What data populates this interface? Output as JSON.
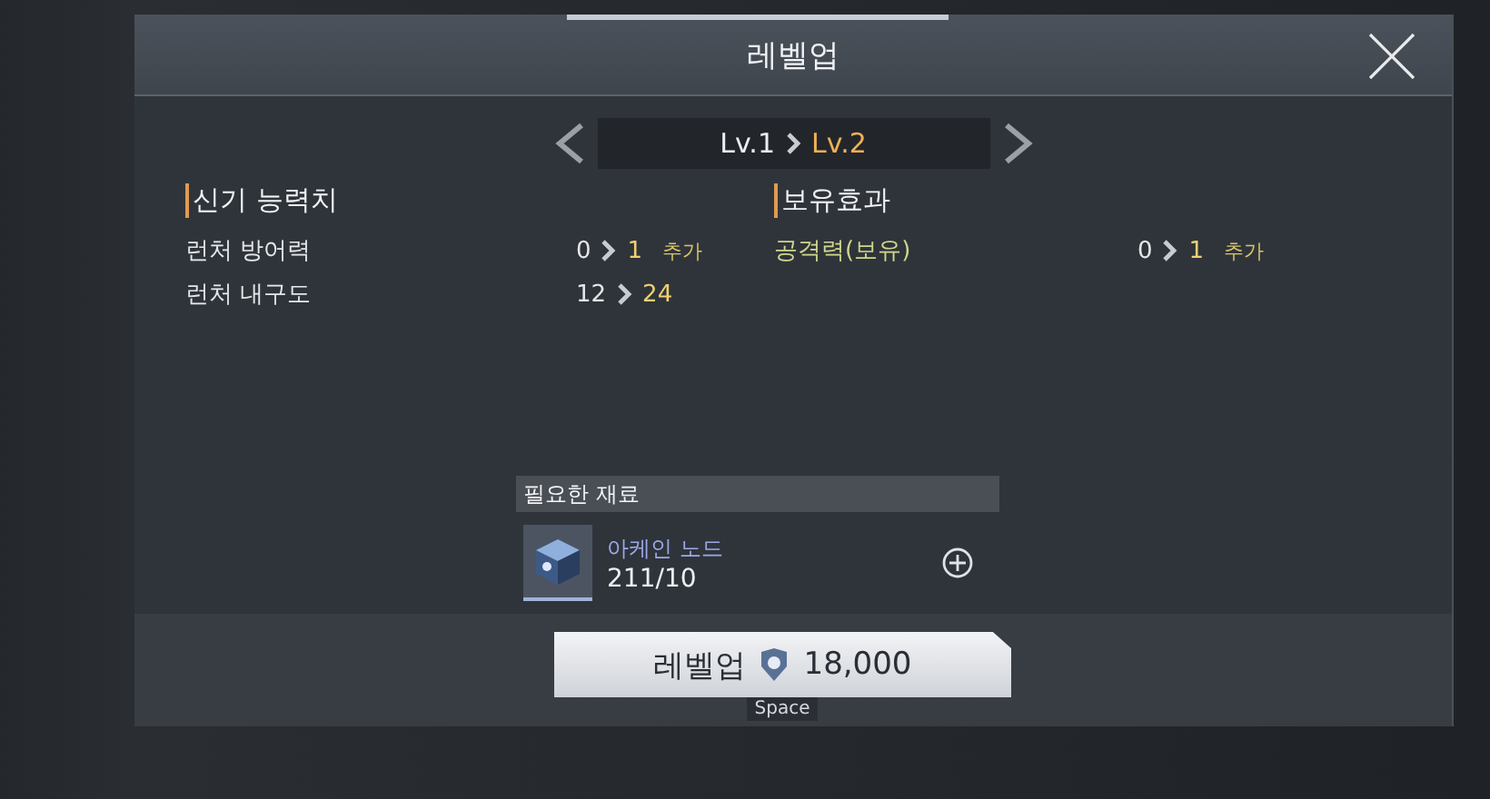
{
  "dialog": {
    "title": "레벨업"
  },
  "level_selector": {
    "from": "Lv.1",
    "to": "Lv.2"
  },
  "stats": {
    "heading": "신기 능력치",
    "rows": [
      {
        "label": "런처 방어력",
        "from": "0",
        "to": "1",
        "suffix": "추가"
      },
      {
        "label": "런처 내구도",
        "from": "12",
        "to": "24"
      }
    ]
  },
  "effects": {
    "heading": "보유효과",
    "rows": [
      {
        "label": "공격력(보유)",
        "from": "0",
        "to": "1",
        "suffix": "추가"
      }
    ]
  },
  "materials": {
    "heading": "필요한 재료",
    "items": [
      {
        "name": "아케인 노드",
        "count": "211/10"
      }
    ]
  },
  "action": {
    "label": "레벨업",
    "cost": "18,000",
    "key": "Space"
  }
}
